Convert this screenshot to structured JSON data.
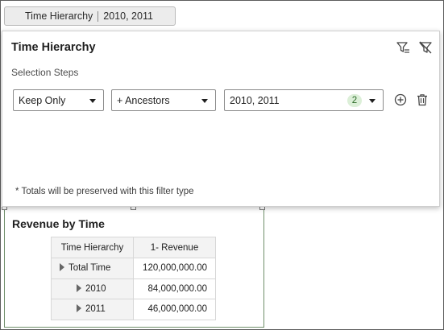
{
  "filter_chip": {
    "label": "Time Hierarchy",
    "value": "2010, 2011"
  },
  "popup": {
    "title": "Time Hierarchy",
    "selection_steps_label": "Selection Steps",
    "step": {
      "action": "Keep Only",
      "relation": "+ Ancestors",
      "members": "2010, 2011",
      "member_count": "2"
    },
    "note": "* Totals will be preserved with this filter type",
    "icons": [
      "filter-options-icon",
      "clear-filter-icon",
      "add-step-icon",
      "delete-step-icon"
    ]
  },
  "report": {
    "title": "Revenue by Time",
    "columns": [
      "Time Hierarchy",
      "1- Revenue"
    ],
    "rows": [
      {
        "label": "Total Time",
        "value": "120,000,000.00"
      },
      {
        "label": "2010",
        "value": "84,000,000.00"
      },
      {
        "label": "2011",
        "value": "46,000,000.00"
      }
    ]
  },
  "colors": {
    "badge_bg": "#dcefd8",
    "badge_text": "#2c6b28",
    "canvas_border": "#6f8f6a"
  }
}
